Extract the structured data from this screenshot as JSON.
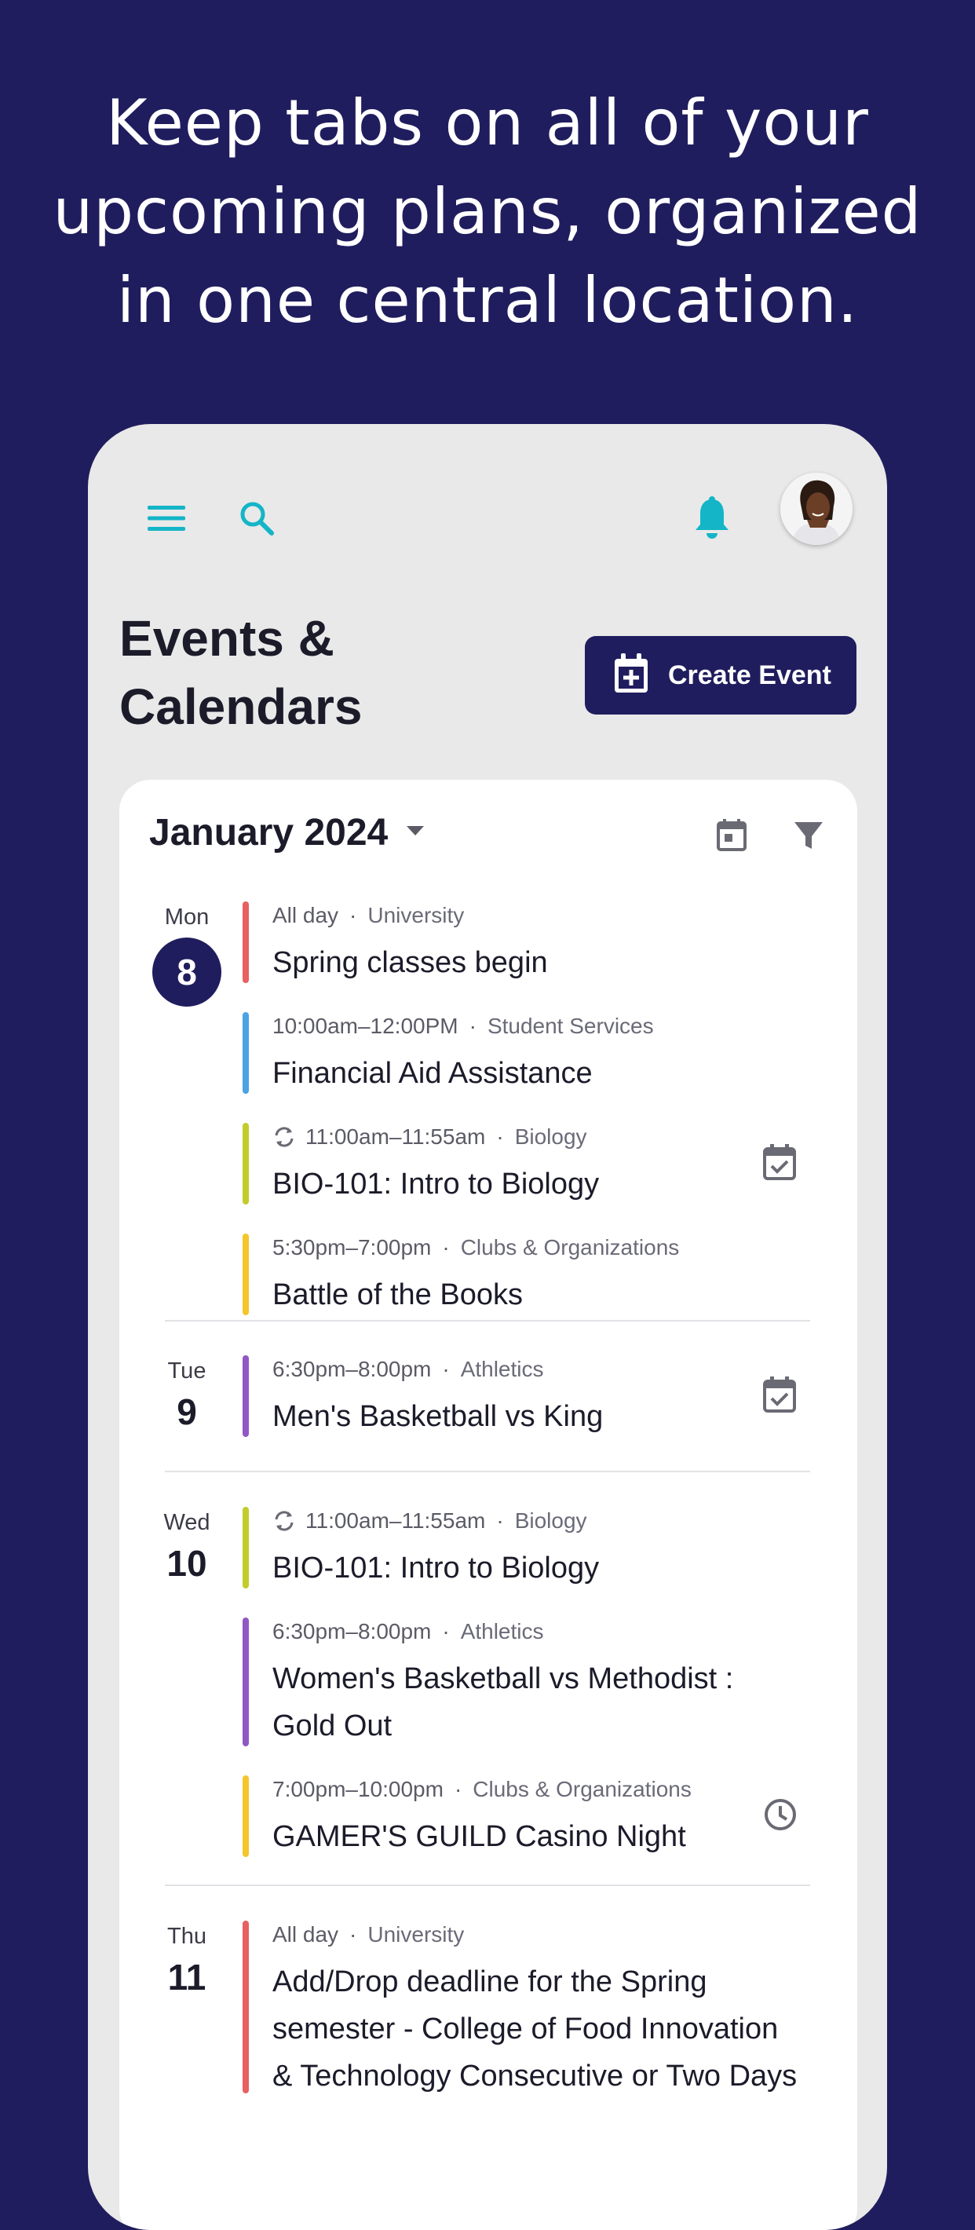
{
  "headline": [
    "Keep tabs on all of your",
    "upcoming plans, organized",
    "in one central location."
  ],
  "colors": {
    "background": "#201d5e",
    "accent": "#14b5c7",
    "primary": "#201d5e"
  },
  "topbar": {
    "menu_icon": "hamburger-menu-icon",
    "search_icon": "search-icon",
    "bell_icon": "bell-icon",
    "avatar": "user-avatar"
  },
  "page": {
    "title_line1": "Events &",
    "title_line2": "Calendars",
    "create_button": "Create Event"
  },
  "calendar": {
    "month": "January 2024",
    "calendar_icon": "calendar-view-icon",
    "filter_icon": "filter-icon"
  },
  "days": [
    {
      "name": "Mon",
      "num": "8",
      "today": true,
      "events": [
        {
          "time": "All day",
          "category": "University",
          "title": "Spring classes begin",
          "color": "#e8605f",
          "repeat": false,
          "icon": null
        },
        {
          "time": "10:00am–12:00PM",
          "category": "Student Services",
          "title": "Financial Aid Assistance",
          "color": "#4ba3e3",
          "repeat": false,
          "icon": null
        },
        {
          "time": "11:00am–11:55am",
          "category": "Biology",
          "title": "BIO-101: Intro to Biology",
          "color": "#c2cc2c",
          "repeat": true,
          "icon": "calendar-check-icon"
        },
        {
          "time": "5:30pm–7:00pm",
          "category": "Clubs & Organizations",
          "title": "Battle of the Books",
          "color": "#f5c52b",
          "repeat": false,
          "icon": null
        }
      ]
    },
    {
      "name": "Tue",
      "num": "9",
      "today": false,
      "events": [
        {
          "time": "6:30pm–8:00pm",
          "category": "Athletics",
          "title": "Men's Basketball vs King",
          "color": "#9158c4",
          "repeat": false,
          "icon": "calendar-check-icon"
        }
      ]
    },
    {
      "name": "Wed",
      "num": "10",
      "today": false,
      "events": [
        {
          "time": "11:00am–11:55am",
          "category": "Biology",
          "title": "BIO-101: Intro to Biology",
          "color": "#c2cc2c",
          "repeat": true,
          "icon": null
        },
        {
          "time": "6:30pm–8:00pm",
          "category": "Athletics",
          "title": "Women's Basketball vs Methodist : Gold Out",
          "color": "#9158c4",
          "repeat": false,
          "icon": null
        },
        {
          "time": "7:00pm–10:00pm",
          "category": "Clubs & Organizations",
          "title": "GAMER'S GUILD Casino Night",
          "color": "#f5c52b",
          "repeat": false,
          "icon": "clock-icon"
        }
      ]
    },
    {
      "name": "Thu",
      "num": "11",
      "today": false,
      "events": [
        {
          "time": "All day",
          "category": "University",
          "title": "Add/Drop deadline for the Spring semester - College of Food Innovation & Technology Consecutive or Two Days",
          "color": "#e8605f",
          "repeat": false,
          "icon": null
        }
      ]
    }
  ]
}
